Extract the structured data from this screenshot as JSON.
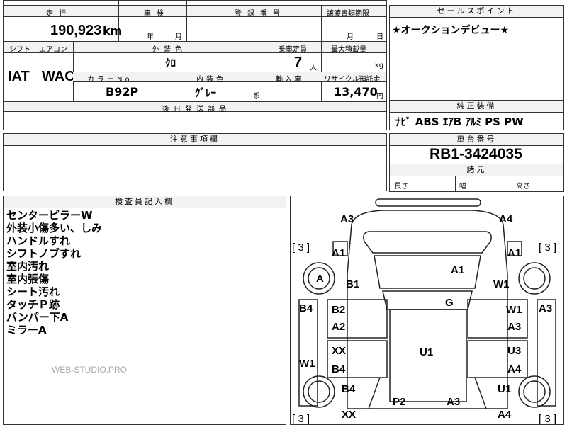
{
  "top_row_partial": [
    "…",
    "…",
    "…"
  ],
  "summary": {
    "headers": {
      "mileage": "走行",
      "inspection": "車検",
      "registration": "登録番号",
      "transfer": "譲渡書類期限",
      "shift": "シフト",
      "aircon": "エアコン",
      "exterior": "外装色",
      "capacity": "乗車定員",
      "max_load": "最大積載量",
      "color_no": "カラーNo.",
      "interior": "内装色",
      "import": "輸入車",
      "recycle": "リサイクル預託金",
      "accessories": "後日発送部品"
    },
    "values": {
      "mileage": "190,923",
      "mileage_unit": "km",
      "inspection_year": "年",
      "inspection_month": "月",
      "transfer_month": "月",
      "transfer_day": "日",
      "shift": "IAT",
      "aircon": "WAC",
      "exterior": "ｸﾛ",
      "capacity": "7",
      "capacity_unit": "人",
      "max_load_unit": "kg",
      "color_no": "B92P",
      "interior": "ｸﾞﾚｰ",
      "interior_suffix": "系",
      "recycle": "13,470",
      "recycle_unit": "円"
    }
  },
  "sales_point": {
    "header": "セールスポイント",
    "text": "★オークションデビュー★"
  },
  "equipment": {
    "header": "純正装備",
    "text": "ﾅﾋﾞ ABS ｴｱB ｱﾙﾐ PS PW"
  },
  "caution": {
    "header": "注意事項欄"
  },
  "chassis": {
    "header": "車台番号",
    "value": "RB1-3424035"
  },
  "dimensions": {
    "header": "諸元",
    "length": "長さ",
    "width": "幅",
    "height": "高さ"
  },
  "inspector": {
    "header": "検査員記入欄",
    "lines": [
      "センターピラーW",
      "外装小傷多い、しみ",
      "ハンドルすれ",
      "シフトノブすれ",
      "室内汚れ",
      "室内張傷",
      "シート汚れ",
      "タッチＰ跡",
      "バンパー下A",
      "ミラーA"
    ],
    "watermark": "WEB-STUDIO.PRO"
  },
  "diagram": {
    "labels": {
      "a3_tl": "A3",
      "a4_tr": "A4",
      "bracket_l": "[ 3 ]",
      "bracket_r": "[ 3 ]",
      "bracket_bl": "[ 3 ]",
      "bracket_br": "[ 3 ]",
      "a1_l": "A1",
      "a1_r": "A1",
      "a_wheel": "A",
      "b1": "B1",
      "a1_hood": "A1",
      "w1_r": "W1",
      "b4_l": "B4",
      "b2": "B2",
      "g": "G",
      "w1_r2": "W1",
      "a3_r": "A3",
      "a2": "A2",
      "a3_r2": "A3",
      "xx1": "XX",
      "u1": "U1",
      "u3": "U3",
      "w1_l": "W1",
      "b4_2": "B4",
      "a4_r": "A4",
      "b4_3": "B4",
      "u1_r": "U1",
      "p2": "P2",
      "a3_b": "A3",
      "xx2": "XX",
      "a4_b": "A4"
    }
  }
}
